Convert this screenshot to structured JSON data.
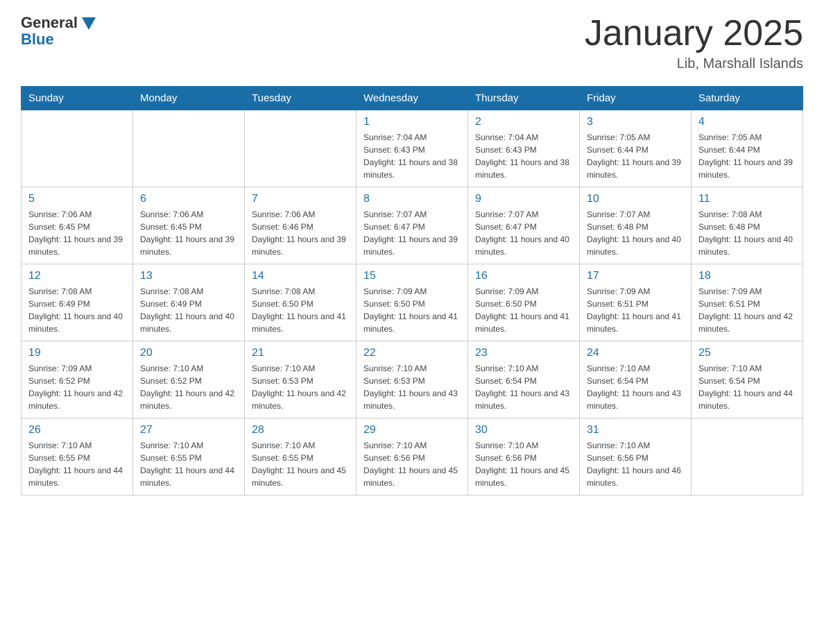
{
  "logo": {
    "general": "General",
    "blue": "Blue"
  },
  "header": {
    "title": "January 2025",
    "location": "Lib, Marshall Islands"
  },
  "days_of_week": [
    "Sunday",
    "Monday",
    "Tuesday",
    "Wednesday",
    "Thursday",
    "Friday",
    "Saturday"
  ],
  "weeks": [
    [
      {
        "day": "",
        "info": ""
      },
      {
        "day": "",
        "info": ""
      },
      {
        "day": "",
        "info": ""
      },
      {
        "day": "1",
        "info": "Sunrise: 7:04 AM\nSunset: 6:43 PM\nDaylight: 11 hours and 38 minutes."
      },
      {
        "day": "2",
        "info": "Sunrise: 7:04 AM\nSunset: 6:43 PM\nDaylight: 11 hours and 38 minutes."
      },
      {
        "day": "3",
        "info": "Sunrise: 7:05 AM\nSunset: 6:44 PM\nDaylight: 11 hours and 39 minutes."
      },
      {
        "day": "4",
        "info": "Sunrise: 7:05 AM\nSunset: 6:44 PM\nDaylight: 11 hours and 39 minutes."
      }
    ],
    [
      {
        "day": "5",
        "info": "Sunrise: 7:06 AM\nSunset: 6:45 PM\nDaylight: 11 hours and 39 minutes."
      },
      {
        "day": "6",
        "info": "Sunrise: 7:06 AM\nSunset: 6:45 PM\nDaylight: 11 hours and 39 minutes."
      },
      {
        "day": "7",
        "info": "Sunrise: 7:06 AM\nSunset: 6:46 PM\nDaylight: 11 hours and 39 minutes."
      },
      {
        "day": "8",
        "info": "Sunrise: 7:07 AM\nSunset: 6:47 PM\nDaylight: 11 hours and 39 minutes."
      },
      {
        "day": "9",
        "info": "Sunrise: 7:07 AM\nSunset: 6:47 PM\nDaylight: 11 hours and 40 minutes."
      },
      {
        "day": "10",
        "info": "Sunrise: 7:07 AM\nSunset: 6:48 PM\nDaylight: 11 hours and 40 minutes."
      },
      {
        "day": "11",
        "info": "Sunrise: 7:08 AM\nSunset: 6:48 PM\nDaylight: 11 hours and 40 minutes."
      }
    ],
    [
      {
        "day": "12",
        "info": "Sunrise: 7:08 AM\nSunset: 6:49 PM\nDaylight: 11 hours and 40 minutes."
      },
      {
        "day": "13",
        "info": "Sunrise: 7:08 AM\nSunset: 6:49 PM\nDaylight: 11 hours and 40 minutes."
      },
      {
        "day": "14",
        "info": "Sunrise: 7:08 AM\nSunset: 6:50 PM\nDaylight: 11 hours and 41 minutes."
      },
      {
        "day": "15",
        "info": "Sunrise: 7:09 AM\nSunset: 6:50 PM\nDaylight: 11 hours and 41 minutes."
      },
      {
        "day": "16",
        "info": "Sunrise: 7:09 AM\nSunset: 6:50 PM\nDaylight: 11 hours and 41 minutes."
      },
      {
        "day": "17",
        "info": "Sunrise: 7:09 AM\nSunset: 6:51 PM\nDaylight: 11 hours and 41 minutes."
      },
      {
        "day": "18",
        "info": "Sunrise: 7:09 AM\nSunset: 6:51 PM\nDaylight: 11 hours and 42 minutes."
      }
    ],
    [
      {
        "day": "19",
        "info": "Sunrise: 7:09 AM\nSunset: 6:52 PM\nDaylight: 11 hours and 42 minutes."
      },
      {
        "day": "20",
        "info": "Sunrise: 7:10 AM\nSunset: 6:52 PM\nDaylight: 11 hours and 42 minutes."
      },
      {
        "day": "21",
        "info": "Sunrise: 7:10 AM\nSunset: 6:53 PM\nDaylight: 11 hours and 42 minutes."
      },
      {
        "day": "22",
        "info": "Sunrise: 7:10 AM\nSunset: 6:53 PM\nDaylight: 11 hours and 43 minutes."
      },
      {
        "day": "23",
        "info": "Sunrise: 7:10 AM\nSunset: 6:54 PM\nDaylight: 11 hours and 43 minutes."
      },
      {
        "day": "24",
        "info": "Sunrise: 7:10 AM\nSunset: 6:54 PM\nDaylight: 11 hours and 43 minutes."
      },
      {
        "day": "25",
        "info": "Sunrise: 7:10 AM\nSunset: 6:54 PM\nDaylight: 11 hours and 44 minutes."
      }
    ],
    [
      {
        "day": "26",
        "info": "Sunrise: 7:10 AM\nSunset: 6:55 PM\nDaylight: 11 hours and 44 minutes."
      },
      {
        "day": "27",
        "info": "Sunrise: 7:10 AM\nSunset: 6:55 PM\nDaylight: 11 hours and 44 minutes."
      },
      {
        "day": "28",
        "info": "Sunrise: 7:10 AM\nSunset: 6:55 PM\nDaylight: 11 hours and 45 minutes."
      },
      {
        "day": "29",
        "info": "Sunrise: 7:10 AM\nSunset: 6:56 PM\nDaylight: 11 hours and 45 minutes."
      },
      {
        "day": "30",
        "info": "Sunrise: 7:10 AM\nSunset: 6:56 PM\nDaylight: 11 hours and 45 minutes."
      },
      {
        "day": "31",
        "info": "Sunrise: 7:10 AM\nSunset: 6:56 PM\nDaylight: 11 hours and 46 minutes."
      },
      {
        "day": "",
        "info": ""
      }
    ]
  ]
}
